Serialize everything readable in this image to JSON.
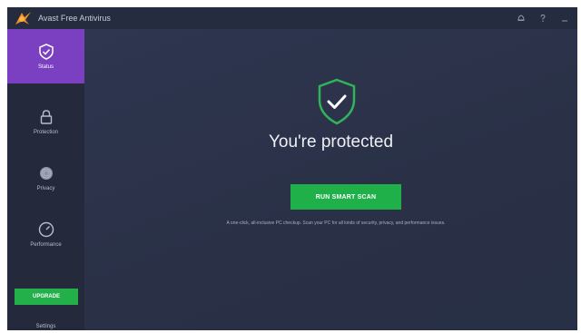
{
  "app": {
    "title": "Avast Free Antivirus",
    "icons": [
      "avast-logo-icon",
      "bell-icon",
      "help-icon",
      "minimize-icon"
    ]
  },
  "sidebar": {
    "items": [
      {
        "label": "Status",
        "icon": "shield-check-icon",
        "active": true
      },
      {
        "label": "Protection",
        "icon": "lock-icon",
        "active": false
      },
      {
        "label": "Privacy",
        "icon": "fingerprint-icon",
        "active": false
      },
      {
        "label": "Performance",
        "icon": "gauge-icon",
        "active": false
      }
    ],
    "upgrade_label": "UPGRADE",
    "settings_label": "Settings"
  },
  "main": {
    "headline": "You're protected",
    "scan_button_label": "RUN SMART SCAN",
    "description": "A one-click, all-inclusive PC checkup. Scan your PC for all kinds of security, privacy, and performance issues."
  },
  "colors": {
    "accent_purple": "#7b3fc1",
    "accent_green": "#1fb04a",
    "sidebar_bg": "#242a3c",
    "main_bg": "#2a3147",
    "logo_orange": "#f28c1c"
  }
}
